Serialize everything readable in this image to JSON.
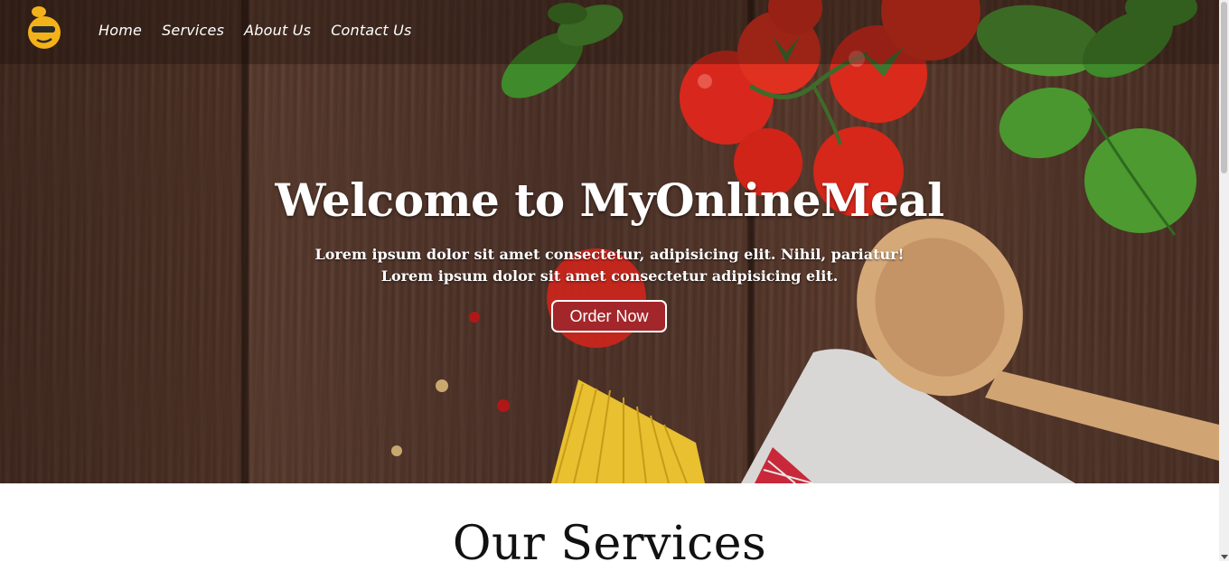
{
  "brand": {
    "logo_icon": "chef-emoji-logo-icon"
  },
  "nav": {
    "items": [
      {
        "label": "Home"
      },
      {
        "label": "Services"
      },
      {
        "label": "About Us"
      },
      {
        "label": "Contact Us"
      }
    ]
  },
  "hero": {
    "title": "Welcome to MyOnlineMeal",
    "subtitle_line1": "Lorem ipsum dolor sit amet consectetur, adipisicing elit. Nihil, pariatur!",
    "subtitle_line2": "Lorem ipsum dolor sit amet consectetur adipisicing elit.",
    "cta_label": "Order Now",
    "cta_color": "#a3262b"
  },
  "services": {
    "title": "Our Services"
  }
}
